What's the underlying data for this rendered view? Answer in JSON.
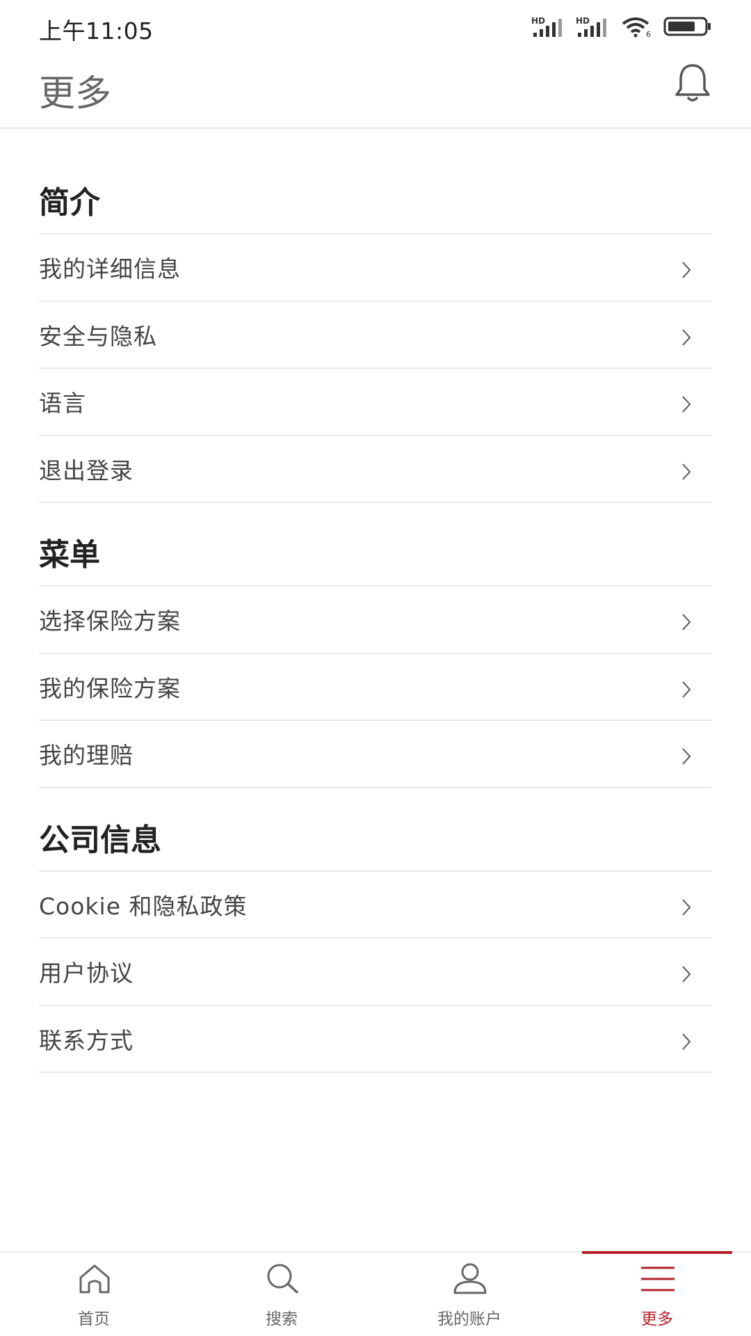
{
  "status_bar": {
    "time": "上午11:05",
    "network_1": "HD",
    "network_2": "HD",
    "wifi_label": "6",
    "icons": [
      "signal-icon",
      "signal-icon",
      "wifi-icon",
      "battery-icon"
    ]
  },
  "header": {
    "title": "更多",
    "notification_icon": "bell-icon"
  },
  "sections": [
    {
      "title": "简介",
      "items": [
        "我的详细信息",
        "安全与隐私",
        "语言",
        "退出登录"
      ]
    },
    {
      "title": "菜单",
      "items": [
        "选择保险方案",
        "我的保险方案",
        "我的理赔"
      ]
    },
    {
      "title": "公司信息",
      "items": [
        "Cookie 和隐私政策",
        "用户协议",
        "联系方式"
      ]
    }
  ],
  "bottom_nav": {
    "items": [
      {
        "label": "首页",
        "icon": "home-icon"
      },
      {
        "label": "搜索",
        "icon": "search-icon"
      },
      {
        "label": "我的账户",
        "icon": "user-icon"
      },
      {
        "label": "更多",
        "icon": "menu-icon"
      }
    ],
    "active_index": 3
  },
  "colors": {
    "accent": "#b3202a",
    "text_primary": "#222222",
    "text_secondary": "#444444",
    "divider": "#e8e8e8"
  }
}
